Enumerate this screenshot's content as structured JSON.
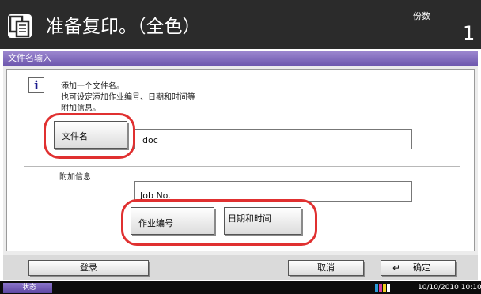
{
  "header": {
    "title": "准备复印。（全色）",
    "copies_label": "份数",
    "copies_value": "1"
  },
  "panel": {
    "title": "文件名输入",
    "message_lines": [
      "添加一个文件名。",
      "也可设定添加作业编号、日期和时间等",
      "附加信息。"
    ],
    "filename_button": "文件名",
    "filename_value": "doc",
    "extra_label": "附加信息",
    "extra_value": "Job No.",
    "job_number_button": "作业编号",
    "date_time_button": "日期和时间"
  },
  "footer": {
    "register": "登录",
    "cancel": "取消",
    "ok": "确定"
  },
  "status": {
    "label": "状态",
    "datetime": "10/10/2010  10:10"
  },
  "colors": {
    "header_bg": "#2b2b2b",
    "accent": "#7b65bb",
    "highlight": "#e03030"
  }
}
